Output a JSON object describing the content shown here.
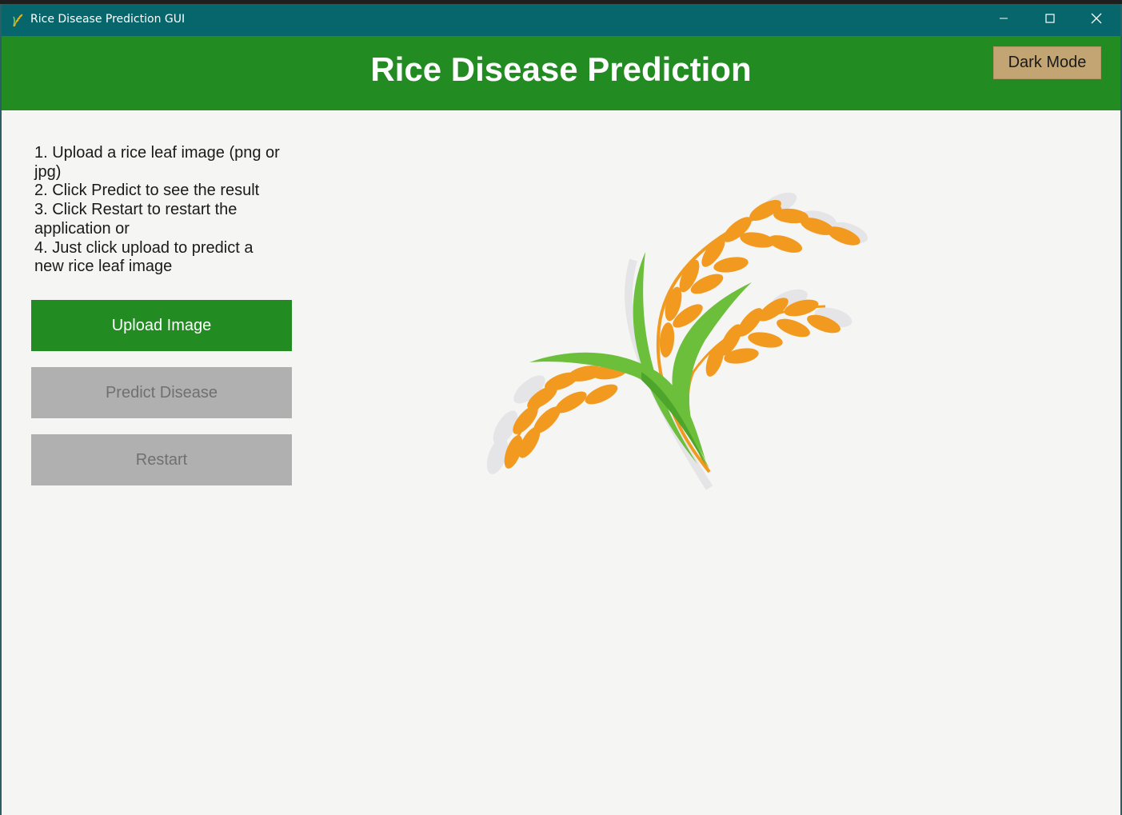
{
  "window": {
    "title": "Rice Disease Prediction GUI"
  },
  "header": {
    "title": "Rice Disease Prediction",
    "dark_mode_label": "Dark Mode"
  },
  "instructions": {
    "lines": [
      "1. Upload a rice leaf image (png or",
      "jpg)",
      "2. Click Predict to see the result",
      "3. Click Restart to restart the",
      "application or",
      "4. Just click upload to predict a",
      "new rice leaf image"
    ]
  },
  "buttons": {
    "upload_label": "Upload Image",
    "predict_label": "Predict Disease",
    "restart_label": "Restart"
  },
  "icons": {
    "app": "rice-plant-icon",
    "minimize": "minimize-icon",
    "maximize": "maximize-icon",
    "close": "close-icon",
    "illustration": "rice-stalk-illustration"
  },
  "colors": {
    "titlebar": "#07666b",
    "header": "#228b22",
    "primary_button": "#228b22",
    "disabled_button": "#b0b0b0",
    "dark_mode_button": "#c3a574",
    "grain": "#f29a1f",
    "leaf": "#6cbf3a"
  }
}
